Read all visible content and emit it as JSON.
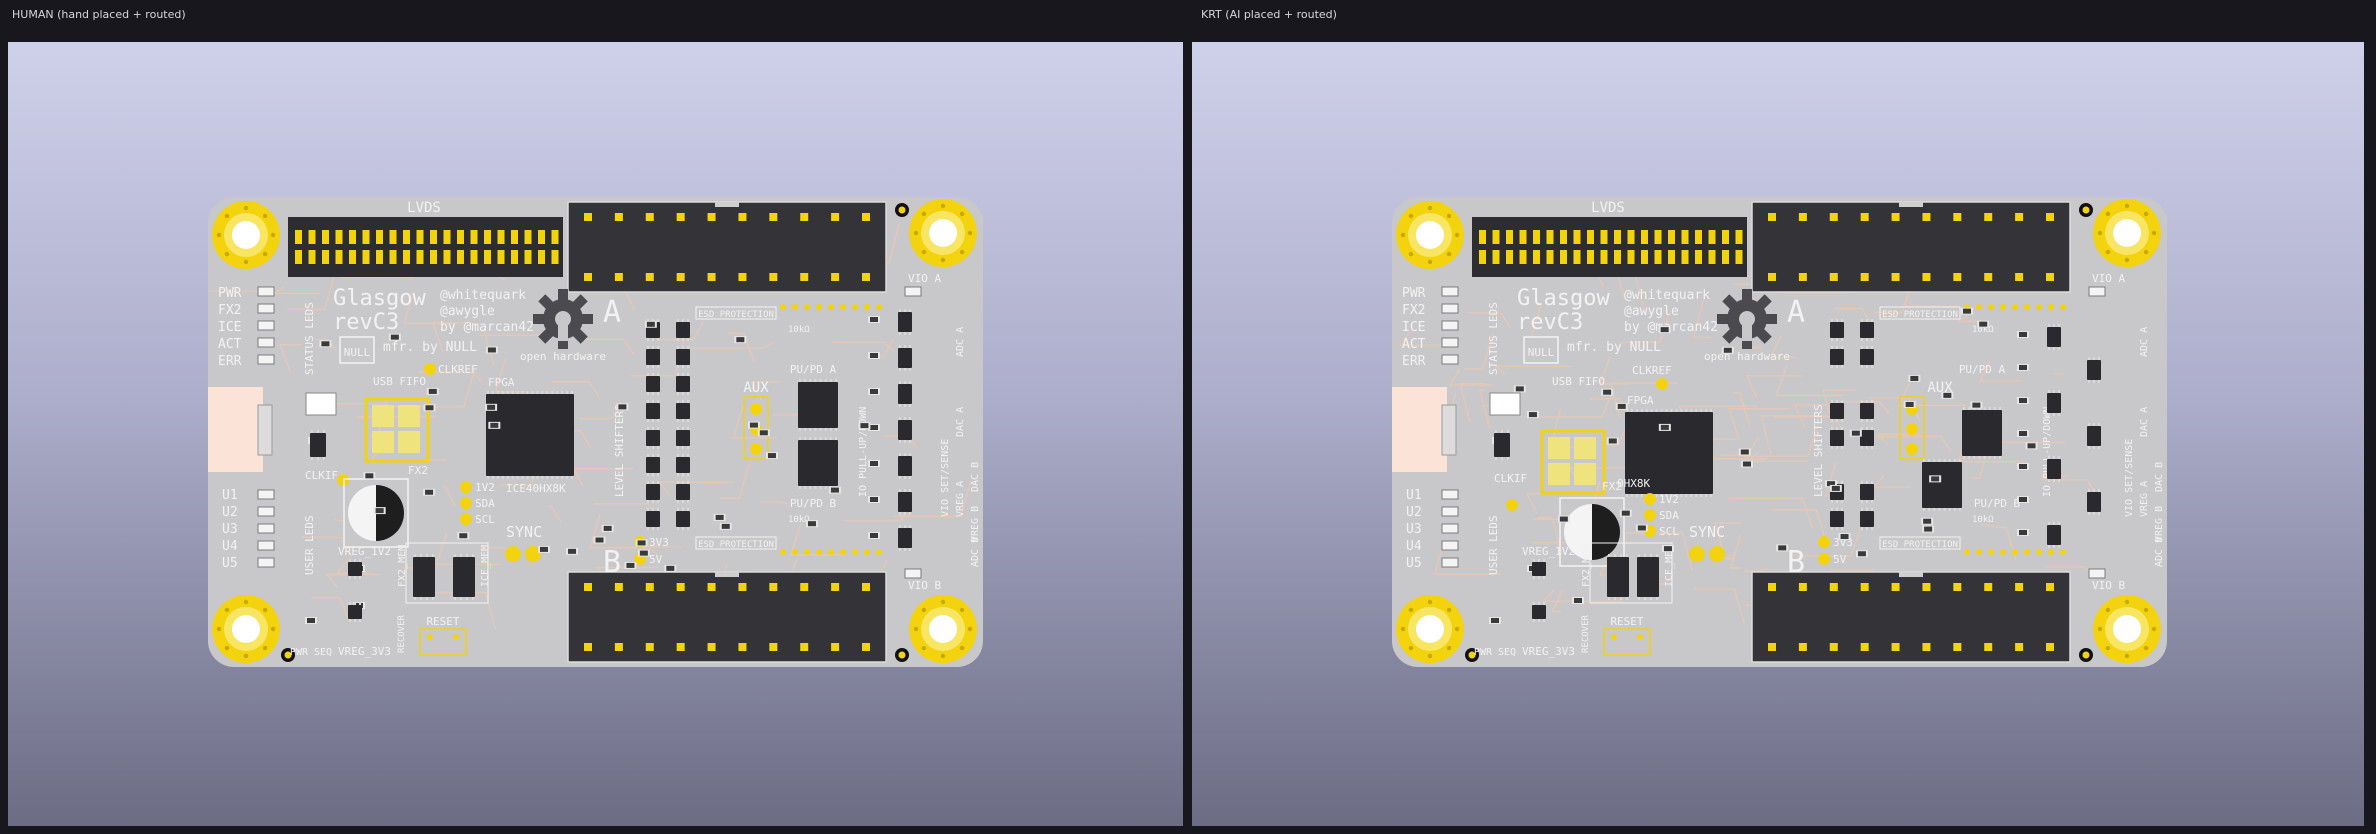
{
  "panels": [
    {
      "title": "HUMAN (hand placed + routed)",
      "variant": "human"
    },
    {
      "title": "KRT (AI placed + routed)",
      "variant": "ai"
    }
  ],
  "board": {
    "lvds": "LVDS",
    "name_line1": "Glasgow",
    "name_line2": "revC3",
    "credits": [
      "@whitequark",
      "@awygle",
      "by @marcan42"
    ],
    "mfr": "mfr. by NULL",
    "null_logo": "NULL",
    "open_hardware": "open hardware",
    "status_leds": [
      "PWR",
      "FX2",
      "ICE",
      "ACT",
      "ERR"
    ],
    "status_label": "STATUS LEDS",
    "user_leds": [
      "U1",
      "U2",
      "U3",
      "U4",
      "U5"
    ],
    "user_label": "USER LEDS",
    "usb_fifo": "USB FIFO",
    "clkref": "CLKREF",
    "fpga": "FPGA",
    "fpga_part": "ICE40HX8K",
    "fx2": "FX2",
    "clkif": "CLKIF",
    "v1v2": "1V2",
    "sda": "SDA",
    "scl": "SCL",
    "sync": "SYNC",
    "v3v3": "3V3",
    "v5": "5V",
    "port_a": "A",
    "port_b": "B",
    "level_shifters": "LEVEL SHIFTERS",
    "esd": "ESD PROTECTION",
    "aux": "AUX",
    "pupd_a": "PU/PD A",
    "pupd_b": "PU/PD B",
    "io_pullup": "IO PULL-UP/DOWN",
    "vio_a": "VIO A",
    "vio_b": "VIO B",
    "adc_a": "ADC A",
    "adc_b": "ADC B",
    "dac_a": "DAC A",
    "dac_b": "DAC B",
    "vreg_a": "VREG A",
    "vreg_b": "VREG B",
    "vio_sense": "VIO SET/SENSE",
    "vreg_1v2": "VREG_1V2",
    "vreg_3v3": "VREG_3V3",
    "fx2_mem": "FX2_MEM",
    "ice_mem": "ICE_MEM",
    "reset": "RESET",
    "recover": "RECOVER",
    "pwr_seq": "PWR SEQ",
    "r10k": "10kΩ",
    "ai_dhxk": "0HX8K"
  }
}
